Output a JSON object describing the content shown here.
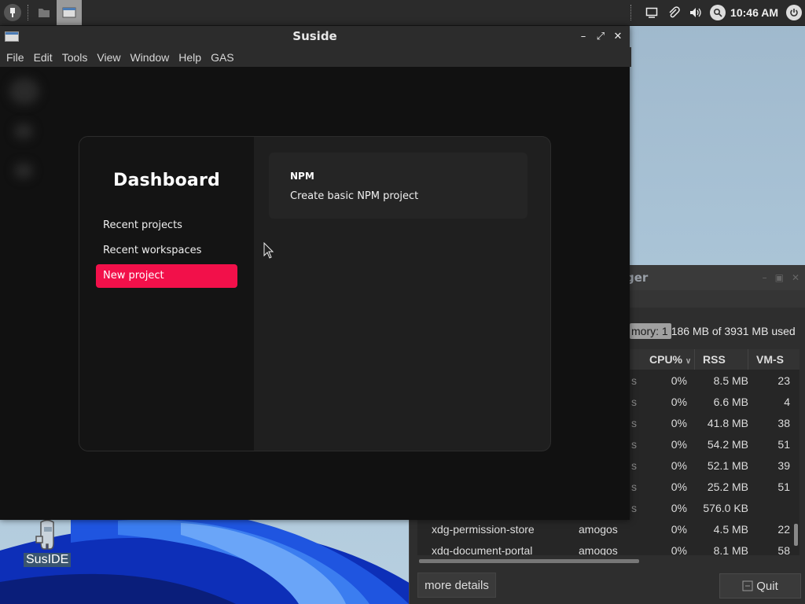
{
  "top_panel": {
    "clock": "10:46 AM",
    "launcher_icon": "menu-icon",
    "tasks": [
      {
        "icon": "file-manager-icon"
      },
      {
        "icon": "suside-window-icon",
        "active": true
      }
    ],
    "tray_icons": [
      "screen-icon",
      "clip-icon",
      "volume-icon",
      "search-icon",
      "power-icon"
    ]
  },
  "suside": {
    "title": "Suside",
    "menu": [
      "File",
      "Edit",
      "Tools",
      "View",
      "Window",
      "Help",
      "GAS"
    ],
    "dashboard": {
      "title": "Dashboard",
      "nav": [
        {
          "label": "Recent projects",
          "active": false
        },
        {
          "label": "Recent workspaces",
          "active": false
        },
        {
          "label": "New project",
          "active": true
        }
      ],
      "card": {
        "title": "NPM",
        "description": "Create basic NPM project"
      }
    },
    "accent_color": "#f2104a"
  },
  "task_manager": {
    "title_fragment": "ger",
    "memory_label": "mory: 1186 MB of 3931 MB used",
    "columns": [
      "CPU%",
      "RSS",
      "VM-S"
    ],
    "rows": [
      {
        "name": "",
        "user": "s",
        "cpu": "0%",
        "rss": "8.5 MB",
        "vms": "23"
      },
      {
        "name": "",
        "user": "s",
        "cpu": "0%",
        "rss": "6.6 MB",
        "vms": "4"
      },
      {
        "name": "",
        "user": "s",
        "cpu": "0%",
        "rss": "41.8 MB",
        "vms": "38"
      },
      {
        "name": "",
        "user": "s",
        "cpu": "0%",
        "rss": "54.2 MB",
        "vms": "51"
      },
      {
        "name": "",
        "user": "s",
        "cpu": "0%",
        "rss": "52.1 MB",
        "vms": "39"
      },
      {
        "name": "",
        "user": "s",
        "cpu": "0%",
        "rss": "25.2 MB",
        "vms": "51"
      },
      {
        "name": "",
        "user": "s",
        "cpu": "0%",
        "rss": "576.0 KB",
        "vms": ""
      },
      {
        "name": "xdg-permission-store",
        "user": "amogos",
        "cpu": "0%",
        "rss": "4.5 MB",
        "vms": "22"
      },
      {
        "name": "xdg-document-portal",
        "user": "amogos",
        "cpu": "0%",
        "rss": "8.1 MB",
        "vms": "58"
      }
    ],
    "more_details_label": "more details",
    "quit_label": "Quit"
  },
  "desktop": {
    "icon_label": "SusIDE"
  }
}
